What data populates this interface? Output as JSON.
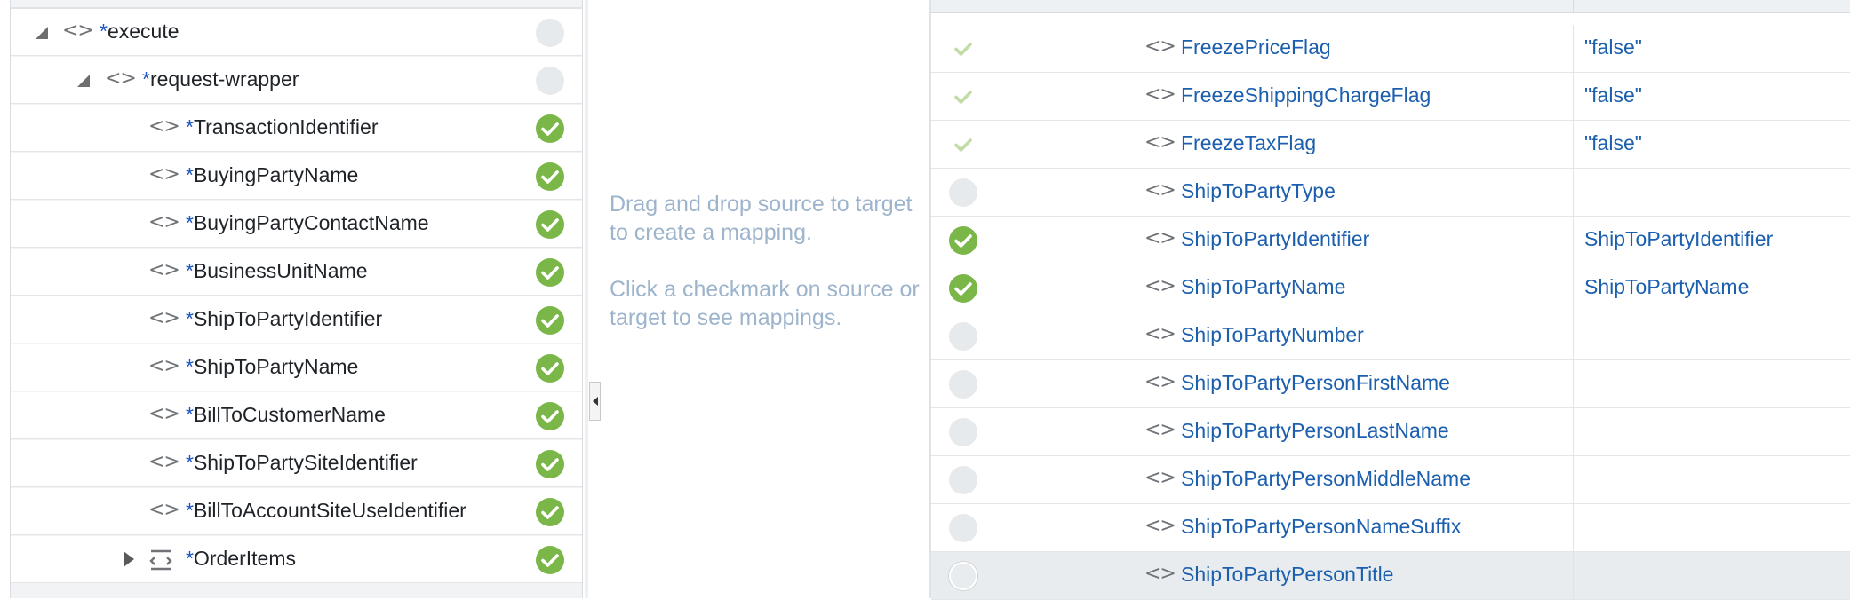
{
  "source_tree": {
    "rows": [
      {
        "name": "execute",
        "required": "*",
        "status": "empty"
      },
      {
        "name": "request-wrapper",
        "required": "*",
        "status": "empty"
      },
      {
        "name": "TransactionIdentifier",
        "required": "*",
        "status": "mapped"
      },
      {
        "name": "BuyingPartyName",
        "required": "*",
        "status": "mapped"
      },
      {
        "name": "BuyingPartyContactName",
        "required": "*",
        "status": "mapped"
      },
      {
        "name": "BusinessUnitName",
        "required": "*",
        "status": "mapped"
      },
      {
        "name": "ShipToPartyIdentifier",
        "required": "*",
        "status": "mapped"
      },
      {
        "name": "ShipToPartyName",
        "required": "*",
        "status": "mapped"
      },
      {
        "name": "BillToCustomerName",
        "required": "*",
        "status": "mapped"
      },
      {
        "name": "ShipToPartySiteIdentifier",
        "required": "*",
        "status": "mapped"
      },
      {
        "name": "BillToAccountSiteUseIdentifier",
        "required": "*",
        "status": "mapped"
      },
      {
        "name": "OrderItems",
        "required": "*",
        "status": "mapped"
      }
    ],
    "code_glyph": "<>",
    "icons": {
      "expand_open": "triangle-expanded-icon",
      "expand_closed": "triangle-collapsed-icon",
      "element": "code-brackets-icon",
      "repeating": "repeating-element-icon",
      "mapped": "check-circle-icon"
    }
  },
  "hint": {
    "line1": "Drag and drop source to target to create a mapping.",
    "line2": "Click a checkmark on source or target to see mappings."
  },
  "target_tree": {
    "rows": [
      {
        "name": "FreezePriceFlag",
        "value": "\"false\"",
        "status": "partial"
      },
      {
        "name": "FreezeShippingChargeFlag",
        "value": "\"false\"",
        "status": "partial"
      },
      {
        "name": "FreezeTaxFlag",
        "value": "\"false\"",
        "status": "partial"
      },
      {
        "name": "ShipToPartyType",
        "value": "",
        "status": "empty"
      },
      {
        "name": "ShipToPartyIdentifier",
        "value": "ShipToPartyIdentifier",
        "status": "mapped"
      },
      {
        "name": "ShipToPartyName",
        "value": "ShipToPartyName",
        "status": "mapped"
      },
      {
        "name": "ShipToPartyNumber",
        "value": "",
        "status": "empty"
      },
      {
        "name": "ShipToPartyPersonFirstName",
        "value": "",
        "status": "empty"
      },
      {
        "name": "ShipToPartyPersonLastName",
        "value": "",
        "status": "empty"
      },
      {
        "name": "ShipToPartyPersonMiddleName",
        "value": "",
        "status": "empty"
      },
      {
        "name": "ShipToPartyPersonNameSuffix",
        "value": "",
        "status": "empty"
      },
      {
        "name": "ShipToPartyPersonTitle",
        "value": "",
        "status": "selected"
      }
    ]
  },
  "colors": {
    "mapped": "#7ab648",
    "partial_check": "#c2dca8",
    "link_text": "#1b5fae",
    "required_star": "#1a55c6",
    "hint_text": "#9db4cc"
  }
}
